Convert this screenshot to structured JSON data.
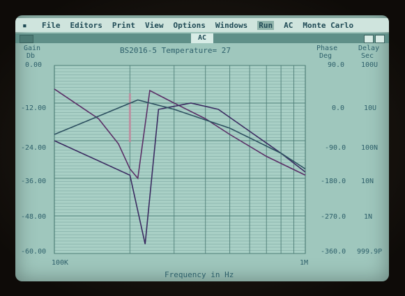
{
  "menubar": {
    "system_glyph": "▪",
    "items": [
      "File",
      "Editors",
      "Print",
      "View",
      "Options",
      "Windows",
      "Run",
      "AC",
      "Monte Carlo"
    ],
    "selected_index": 6
  },
  "window": {
    "title": "AC"
  },
  "plot": {
    "heading": "BS2016-5 Temperature= 27",
    "left_axis": {
      "label_line1": "Gain",
      "label_line2": "Db"
    },
    "phase_axis": {
      "label_line1": "Phase",
      "label_line2": "Deg"
    },
    "delay_axis": {
      "label_line1": "Delay",
      "label_line2": "Sec"
    },
    "xlabel": "Frequency in Hz",
    "x_ticks": [
      "100K",
      "1M"
    ]
  },
  "chart_data": {
    "type": "line",
    "title": "BS2016-5 Temperature= 27",
    "xlabel": "Frequency in Hz",
    "x_scale": "log",
    "xlim": [
      100000,
      1000000
    ],
    "x_tick_labels": [
      "100K",
      "1M"
    ],
    "gain_axis": {
      "label": "Gain Db",
      "ylim": [
        -60,
        0
      ],
      "tick_labels": [
        "0.00",
        "-12.00",
        "-24.00",
        "-36.00",
        "-48.00",
        "-60.00"
      ]
    },
    "phase_axis": {
      "label": "Phase Deg",
      "ylim": [
        -360,
        90
      ],
      "tick_labels": [
        "90.0",
        "0.0",
        "-90.0",
        "-180.0",
        "-270.0",
        "-360.0"
      ]
    },
    "delay_axis": {
      "label": "Delay Sec",
      "tick_labels": [
        "100U",
        "10U",
        "100N",
        "10N",
        "1N",
        "999.9P"
      ]
    },
    "grid": true,
    "series": [
      {
        "x": [
          100000,
          150000,
          180000,
          200000,
          215000,
          240000,
          300000,
          400000,
          500000,
          700000,
          1000000
        ],
        "y": [
          -7.5,
          -17,
          -25,
          -33,
          -36,
          -8,
          -12,
          -17,
          -22,
          -29,
          -35
        ]
      },
      {
        "x": [
          100000,
          200000,
          230000,
          260000,
          350000,
          450000,
          600000,
          800000,
          1000000
        ],
        "y": [
          -24,
          -35,
          -57,
          -14,
          -12,
          -14,
          -21,
          -28,
          -34
        ]
      },
      {
        "x": [
          100000,
          215000,
          300000,
          500000,
          800000,
          1000000
        ],
        "y": [
          -22,
          -11,
          -14,
          -20,
          -28,
          -33
        ]
      }
    ],
    "colors": {
      "gain": "#5a2e66",
      "phase": "#3a2a60",
      "delay": "#2d5060",
      "grid": "#4f7f78",
      "cursor": "#c98aa0"
    }
  }
}
